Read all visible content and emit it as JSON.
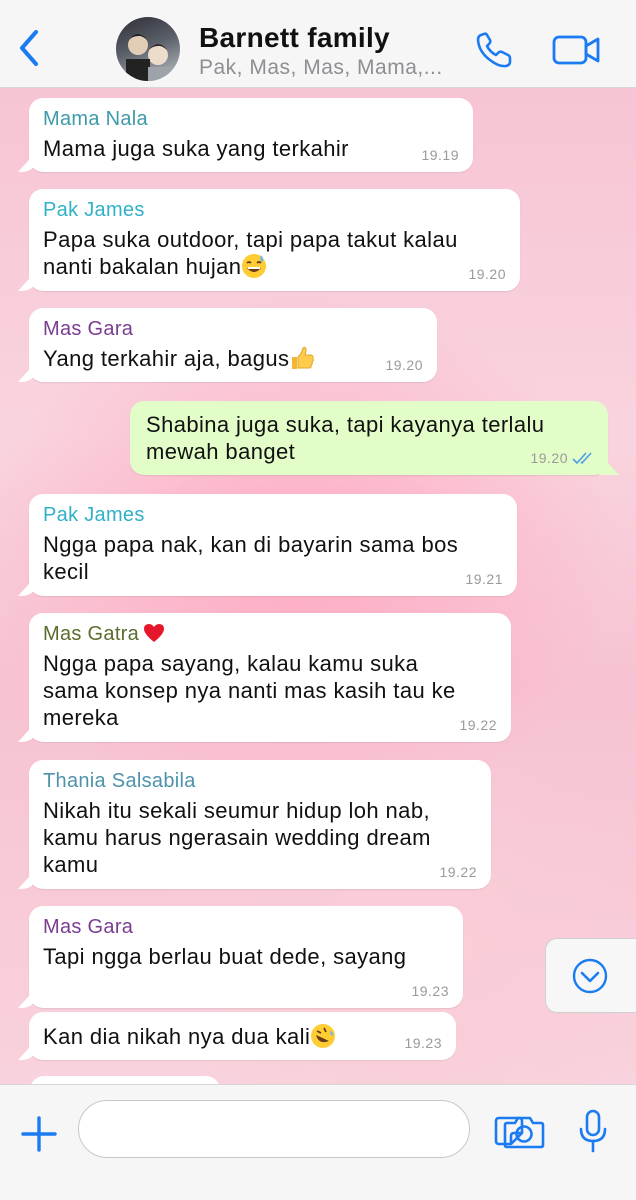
{
  "header": {
    "title": "Barnett family",
    "subtitle": "Pak, Mas, Mas, Mama,...",
    "accent": "#1a7bf2"
  },
  "messages": [
    {
      "sender": "Mama Nala",
      "text": [
        "Mama juga suka yang terkahir"
      ],
      "time": "19.19"
    },
    {
      "sender": "Pak James",
      "text": [
        "Papa suka outdoor, tapi papa takut kalau",
        "nanti bakalan hujan"
      ],
      "emoji": "sweat-smile",
      "time": "19.20"
    },
    {
      "sender": "Mas Gara",
      "text": [
        "Yang terkahir aja, bagus"
      ],
      "emoji": "thumbs-up",
      "time": "19.20"
    },
    {
      "sender": "",
      "text": [
        "Shabina juga suka, tapi kayanya terlalu",
        "mewah banget"
      ],
      "time": "19.20",
      "outgoing": true,
      "status": "read"
    },
    {
      "sender": "Pak James",
      "text": [
        "Ngga papa nak, kan di bayarin sama bos",
        "kecil"
      ],
      "time": "19.21"
    },
    {
      "sender": "Mas Gatra",
      "sender_emoji": "heart",
      "text": [
        "Ngga papa sayang, kalau kamu suka",
        "sama konsep nya nanti mas kasih tau ke",
        "mereka"
      ],
      "time": "19.22"
    },
    {
      "sender": "Thania Salsabila",
      "text": [
        "Nikah itu sekali seumur hidup loh nab,",
        "kamu harus ngerasain wedding dream",
        "kamu"
      ],
      "time": "19.22"
    },
    {
      "sender": "Mas Gara",
      "text": [
        "Tapi ngga berlau buat dede, sayang"
      ],
      "time": "19.23"
    },
    {
      "sender": "",
      "text": [
        "Kan dia nikah nya dua kali"
      ],
      "emoji": "rolling-laughing",
      "time": "19.23"
    }
  ],
  "composer": {
    "placeholder": ""
  },
  "icons": [
    "back-chevron-icon",
    "phone-icon",
    "video-camera-icon",
    "chevron-down-icon",
    "plus-icon",
    "sticker-icon",
    "camera-icon",
    "microphone-icon"
  ]
}
